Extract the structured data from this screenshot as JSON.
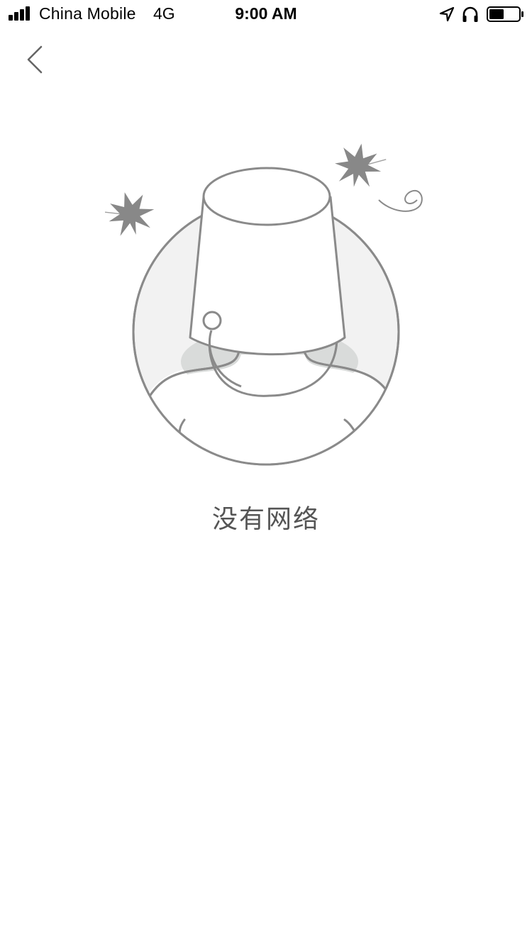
{
  "status_bar": {
    "carrier": "China Mobile",
    "network": "4G",
    "time": "9:00 AM",
    "icons": [
      "signal-icon",
      "location-icon",
      "headphones-icon",
      "battery-icon"
    ]
  },
  "nav": {
    "back_icon": "chevron-left-icon"
  },
  "empty_state": {
    "illustration": "no-network-illustration",
    "message": "没有网络"
  },
  "colors": {
    "line": "#8a8a8a",
    "fill_light": "#f2f2f2",
    "fill_shadow": "#d9dbda",
    "text": "#555555"
  }
}
